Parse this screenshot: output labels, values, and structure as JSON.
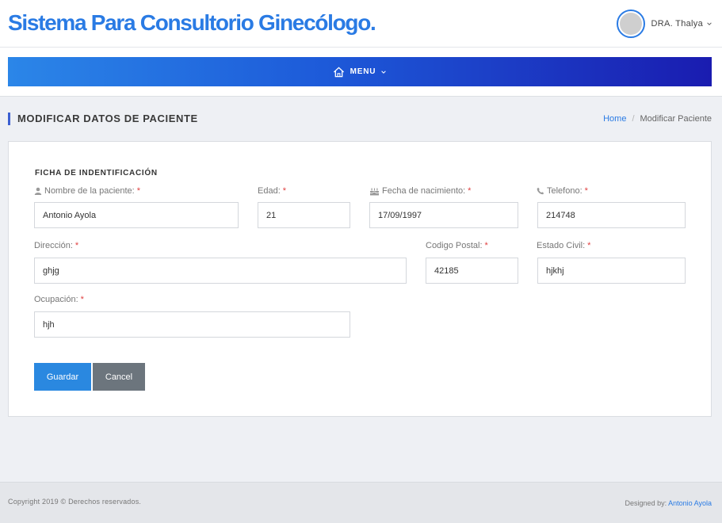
{
  "header": {
    "brand": "Sistema Para Consultorio Ginecólogo.",
    "user_name": "DRA. Thalya"
  },
  "nav": {
    "menu_label": "MENU"
  },
  "page": {
    "title": "MODIFICAR DATOS DE PACIENTE",
    "breadcrumb": [
      "Home",
      "/",
      "Modificar Paciente"
    ]
  },
  "form": {
    "section_title": "FICHA DE INDENTIFICACIÓN",
    "required_mark": "*",
    "fields": {
      "nombre": {
        "label": "Nombre de la paciente:",
        "value": "Antonio Ayola",
        "icon": "user-icon"
      },
      "edad": {
        "label": "Edad:",
        "value": "21"
      },
      "fecha": {
        "label": "Fecha de nacimiento:",
        "value": "17/09/1997",
        "icon": "birthday-cake-icon"
      },
      "telefono": {
        "label": "Telefono:",
        "value": "214748",
        "icon": "phone-icon"
      },
      "direccion": {
        "label": "Dirección:",
        "value": "ghjg"
      },
      "codigo_postal": {
        "label": "Codigo Postal:",
        "value": "42185"
      },
      "estado_civil": {
        "label": "Estado Civil:",
        "value": "hjkhj"
      },
      "ocupacion": {
        "label": "Ocupación:",
        "value": "hjh"
      }
    },
    "save_label": "Guardar",
    "cancel_label": "Cancel"
  },
  "footer": {
    "copyright": "Copyright 2019 © Derechos reservados.",
    "designed_prefix": "Designed by:",
    "designed_author": "Antonio Ayola"
  },
  "colors": {
    "brand": "#2a7be4",
    "nav_gradient_start": "#2b86e8",
    "nav_gradient_end": "#1a1cb0",
    "save_button": "#2a88e0",
    "cancel_button": "#6c757d",
    "required": "#e04040"
  }
}
